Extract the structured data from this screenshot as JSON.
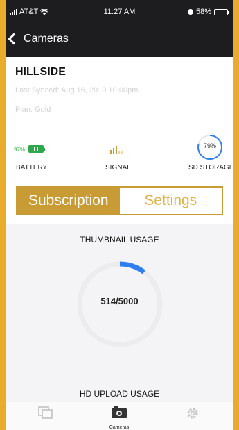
{
  "status_bar": {
    "carrier": "AT&T",
    "time": "11:27 AM",
    "battery_percent": "58%"
  },
  "nav": {
    "back_label": "Cameras"
  },
  "camera": {
    "name": "HILLSIDE",
    "last_synced": "Last Synced: Aug 16, 2019 10:00pm",
    "plan": "Plan: Gold"
  },
  "stats": {
    "battery": {
      "value": "97%",
      "label": "BATTERY",
      "level": 0.97
    },
    "signal": {
      "label": "SIGNAL",
      "level_bars": 3,
      "total_bars": 5
    },
    "sd_storage": {
      "value": "79%",
      "label": "SD STORAGE",
      "fraction": 0.79
    }
  },
  "segments": {
    "active": "Subscription",
    "inactive": "Settings"
  },
  "usage": {
    "thumbnail_title": "THUMBNAIL USAGE",
    "thumbnail_value": "514/5000",
    "thumbnail_fraction": 0.1028,
    "hd_title": "HD UPLOAD USAGE"
  },
  "tabbar": {
    "center_label": "Cameras"
  },
  "colors": {
    "accent": "#c99b34",
    "frame": "#e9ab2a",
    "progress_blue": "#2f7ff0",
    "battery_green": "#2ea84a"
  }
}
